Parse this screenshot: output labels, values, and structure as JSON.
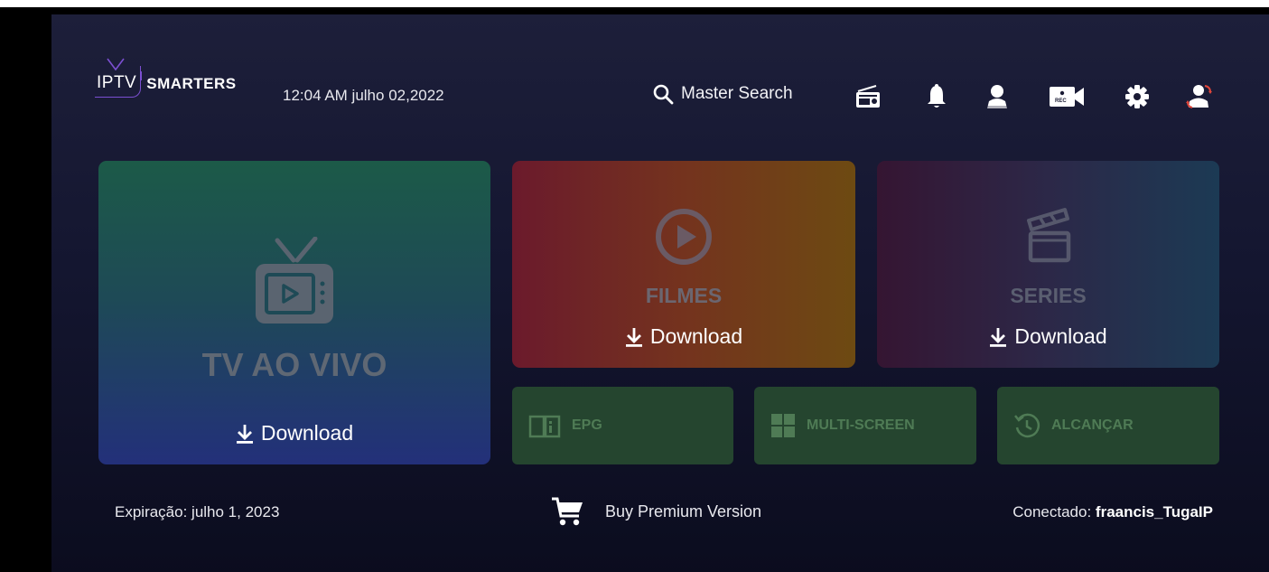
{
  "header": {
    "logo_prefix": "IPTV",
    "logo_brand": "SMARTERS",
    "datetime": "12:04 AM  julho 02,2022",
    "search_label": "Master Search",
    "icons": [
      "radio-icon",
      "bell-icon",
      "user-icon",
      "rec-camera-icon",
      "gear-icon",
      "switch-user-icon"
    ]
  },
  "tiles": {
    "live": {
      "title": "TV AO VIVO",
      "download": "Download"
    },
    "movies": {
      "title": "FILMES",
      "download": "Download"
    },
    "series": {
      "title": "SERIES",
      "download": "Download"
    },
    "epg": {
      "label": "EPG"
    },
    "multiscreen": {
      "label": "MULTI-SCREEN"
    },
    "catchup": {
      "label": "ALCANÇAR"
    }
  },
  "footer": {
    "expiration": "Expiração: julho 1, 2023",
    "buy_premium": "Buy Premium Version",
    "connected_label": "Conectado:",
    "connected_user": "fraancis_TugaIP"
  },
  "colors": {
    "accent_purple": "#7b4fd1",
    "live_tile": "#1e4a56",
    "movies_tile": "#74331e",
    "series_tile": "#2c2848",
    "small_tile": "#25452f"
  }
}
